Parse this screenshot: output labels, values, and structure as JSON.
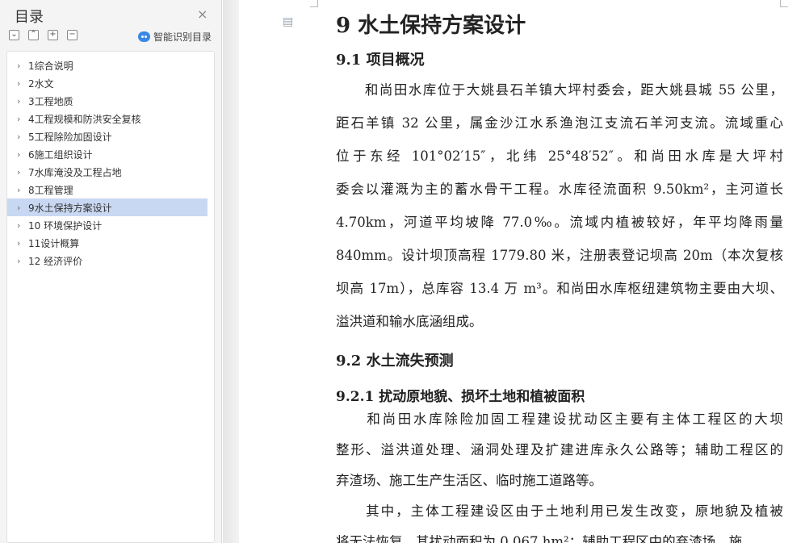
{
  "sidebar": {
    "title": "目录",
    "close_icon": "×",
    "tools": [
      "⌄",
      "⌃",
      "+",
      "−"
    ],
    "smart_label": "智能识别目录",
    "items": [
      {
        "label": "1综合说明"
      },
      {
        "label": "2水文"
      },
      {
        "label": "3工程地质"
      },
      {
        "label": "4工程规模和防洪安全复核"
      },
      {
        "label": "5工程除险加固设计"
      },
      {
        "label": "6施工组织设计"
      },
      {
        "label": "7水库淹没及工程占地"
      },
      {
        "label": "8工程管理"
      },
      {
        "label": "9水土保持方案设计",
        "active": true
      },
      {
        "label": "10  环境保护设计"
      },
      {
        "label": "11设计概算"
      },
      {
        "label": "12  经济评价"
      }
    ]
  },
  "document": {
    "doc_icon": "▤",
    "h1": "9  水土保持方案设计",
    "s91": "9.1  项目概况",
    "p1_lines": [
      "　　和尚田水库位于大姚县石羊镇大坪村委会，距大姚县城 55 公里，",
      "距石羊镇 32 公里，属金沙江水系渔泡江支流石羊河支流。流域重心",
      "位于东经 101°02′15″，北纬 25°48′52″。和尚田水库是大坪村",
      "委会以灌溉为主的蓄水骨干工程。水库径流面积 9.50km²，主河道长",
      "4.70km，河道平均坡降 77.0‰。流域内植被较好，年平均降雨量",
      "840mm。设计坝顶高程 1779.80 米，注册表登记坝高 20m（本次复核",
      "坝高 17m），总库容 13.4 万 m³。和尚田水库枢纽建筑物主要由大坝、",
      "溢洪道和输水底涵组成。"
    ],
    "s92": "9.2  水土流失预测",
    "s921": "9.2.1  扰动原地貌、损坏土地和植被面积",
    "p2_lines": [
      "　　和尚田水库除险加固工程建设扰动区主要有主体工程区的大坝",
      "整形、溢洪道处理、涵洞处理及扩建进库永久公路等；辅助工程区的",
      "弃渣场、施工生产生活区、临时施工道路等。",
      "　　其中，主体工程建设区由于土地利用已发生改变，原地貌及植被",
      "将无法恢复，其扰动面积为 0.067 hm²；辅助工程区中的弃渣场、施"
    ]
  }
}
